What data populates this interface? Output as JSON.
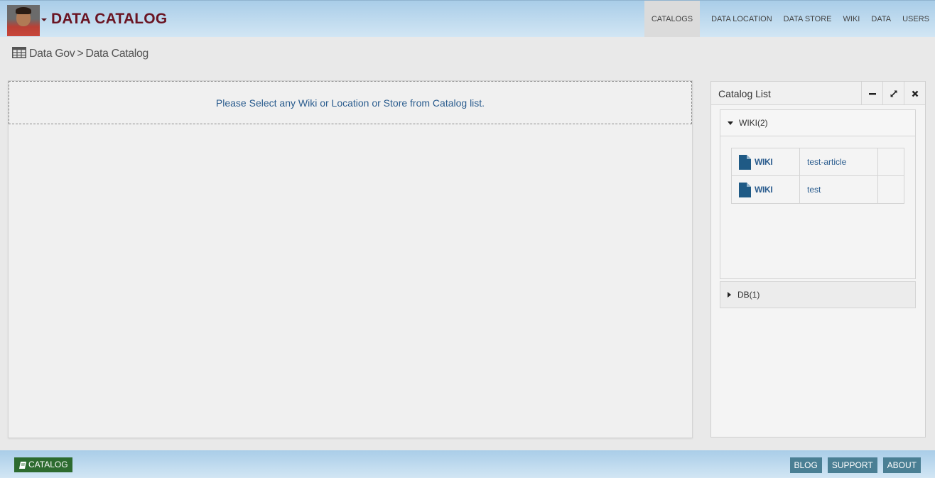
{
  "header": {
    "brand": "DATA CATALOG",
    "nav": [
      "CATALOGS",
      "DATA LOCATION",
      "DATA STORE",
      "WIKI",
      "DATA",
      "USERS"
    ],
    "active_nav": "CATALOGS"
  },
  "breadcrumb": {
    "root": "Data Gov",
    "separator": ">",
    "current": "Data Catalog"
  },
  "main": {
    "notice": "Please Select any Wiki or Location or Store from Catalog list."
  },
  "catalog_list": {
    "title": "Catalog List",
    "buttons": [
      "minimize-icon",
      "expand-icon",
      "close-icon"
    ],
    "sections": [
      {
        "label": "WIKI(2)",
        "expanded": true,
        "items": [
          {
            "type": "WIKI",
            "name": "test-article"
          },
          {
            "type": "WIKI",
            "name": "test"
          }
        ]
      },
      {
        "label": "DB(1)",
        "expanded": false
      }
    ]
  },
  "footer": {
    "catalog_button": "CATALOG",
    "links": [
      "BLOG",
      "SUPPORT",
      "ABOUT"
    ]
  },
  "colors": {
    "brand": "#6a1422",
    "link": "#2a5c8e",
    "catalog_button_bg": "#2d6b2f",
    "footer_button_bg": "#4a7f94"
  }
}
